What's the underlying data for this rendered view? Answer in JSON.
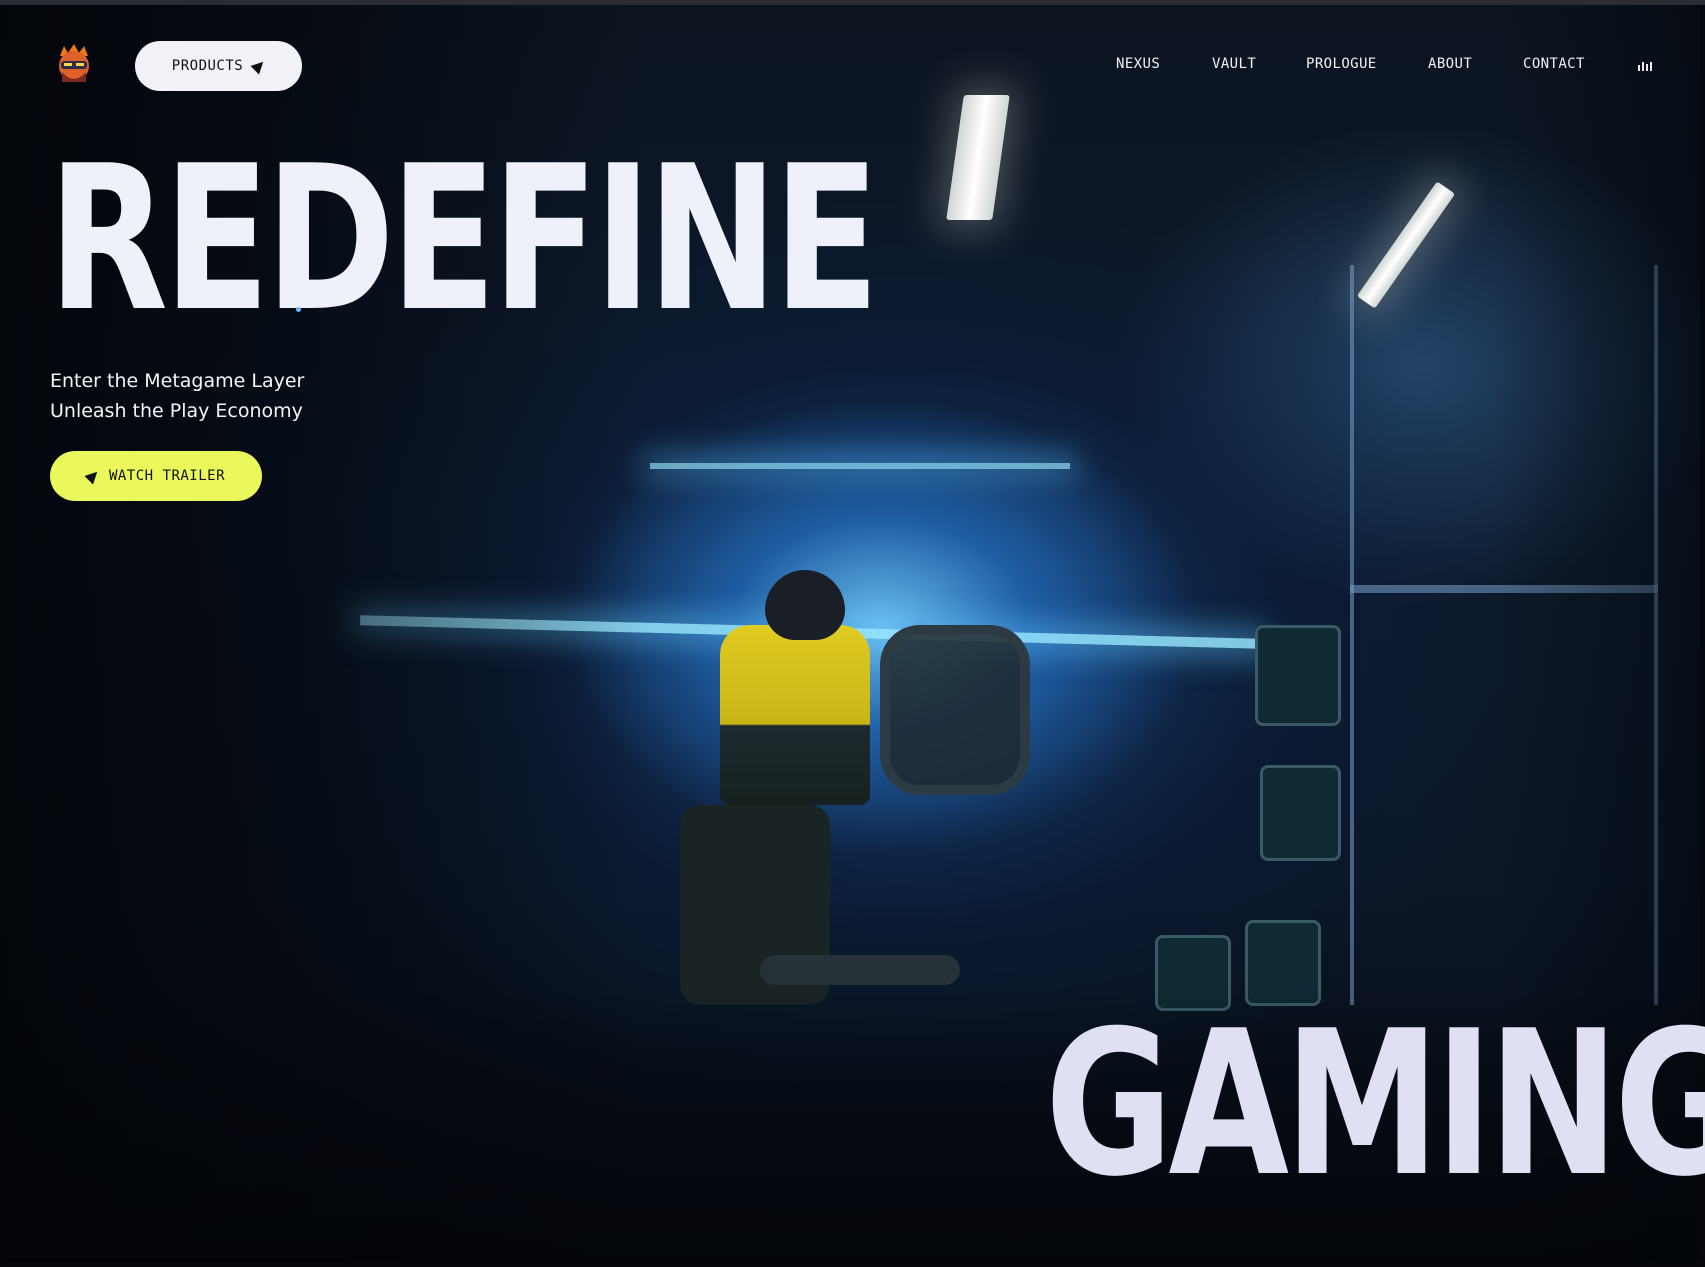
{
  "nav": {
    "logo_icon": "ninja-avatar-logo",
    "products_label": "PRODUCTS",
    "links": [
      "NEXUS",
      "VAULT",
      "PROLOGUE",
      "ABOUT",
      "CONTACT"
    ],
    "audio_icon": "audio-bars-icon"
  },
  "hero": {
    "headline_top": "REDEFINE",
    "headline_bottom": "GAMING",
    "tagline_line1": "Enter the Metagame Layer",
    "tagline_line2": "Unleash the Play Economy",
    "trailer_label": "WATCH TRAILER"
  },
  "colors": {
    "accent": "#eaf85c",
    "headline": "#eef1f9",
    "button_light": "#f1f2f8"
  }
}
